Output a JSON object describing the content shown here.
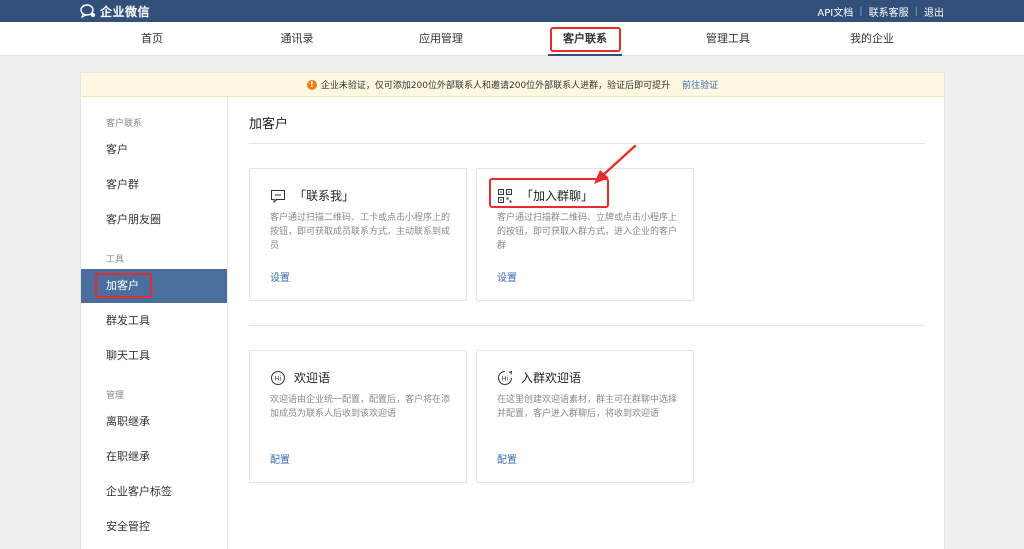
{
  "topbar": {
    "logo_text": "企业微信",
    "links": [
      "API文档",
      "联系客服",
      "退出"
    ]
  },
  "nav": {
    "items": [
      "首页",
      "通讯录",
      "应用管理",
      "客户联系",
      "管理工具",
      "我的企业"
    ],
    "active": "客户联系"
  },
  "notice": {
    "text": "企业未验证，仅可添加200位外部联系人和邀请200位外部联系人进群，验证后即可提升",
    "link": "前往验证"
  },
  "sidebar": {
    "groups": [
      {
        "label": "客户联系",
        "items": [
          "客户",
          "客户群",
          "客户朋友圈"
        ]
      },
      {
        "label": "工具",
        "items": [
          "加客户",
          "群发工具",
          "聊天工具"
        ]
      },
      {
        "label": "管理",
        "items": [
          "离职继承",
          "在职继承",
          "企业客户标签",
          "安全管控"
        ]
      }
    ],
    "active": "加客户"
  },
  "main": {
    "title": "加客户",
    "cards": [
      {
        "icon": "chat-bubble-icon",
        "title": "「联系我」",
        "desc": "客户通过扫描二维码、工卡或点击小程序上的按钮，即可获取成员联系方式，主动联系到成员",
        "action": "设置"
      },
      {
        "icon": "qr-code-icon",
        "title": "「加入群聊」",
        "desc": "客户通过扫描群二维码、立牌或点击小程序上的按钮，即可获取入群方式，进入企业的客户群",
        "action": "设置"
      },
      {
        "icon": "hi-bubble-icon",
        "title": "欢迎语",
        "desc": "欢迎语由企业统一配置，配置后，客户将在添加成员为联系人后收到该欢迎语",
        "action": "配置"
      },
      {
        "icon": "group-hi-bubble-icon",
        "title": "入群欢迎语",
        "desc": "在这里创建欢迎语素材，群主可在群聊中选择并配置，客户进入群聊后，将收到欢迎语",
        "action": "配置"
      }
    ]
  },
  "colors": {
    "topbar": "#33507a",
    "sidebar_active": "#4a6f9f",
    "link": "#3a6bb0",
    "highlight": "#e52d2d",
    "notice_bg": "#fdf8df"
  }
}
